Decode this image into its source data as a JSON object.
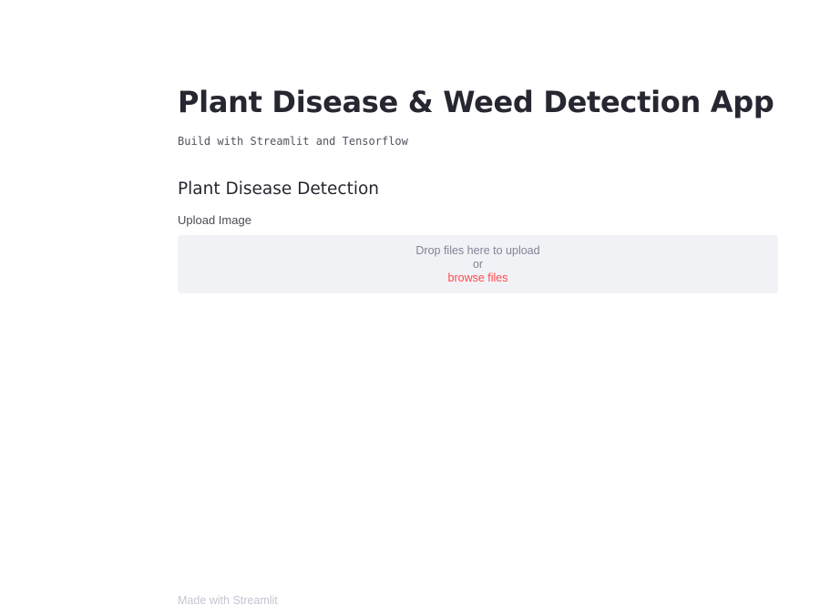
{
  "header": {
    "title": "Plant Disease & Weed Detection App",
    "subtitle": "Build with Streamlit and Tensorflow"
  },
  "section": {
    "heading": "Plant Disease Detection",
    "uploader": {
      "label": "Upload Image",
      "drop_text": "Drop files here to upload",
      "or_text": "or",
      "browse_text": "browse files"
    }
  },
  "footer": {
    "text": "Made with Streamlit"
  },
  "colors": {
    "text": "#262730",
    "accent": "#ff4b4b",
    "dropzone_bg": "#f0f2f6",
    "muted": "#808495",
    "footer": "#c4c6cf"
  }
}
